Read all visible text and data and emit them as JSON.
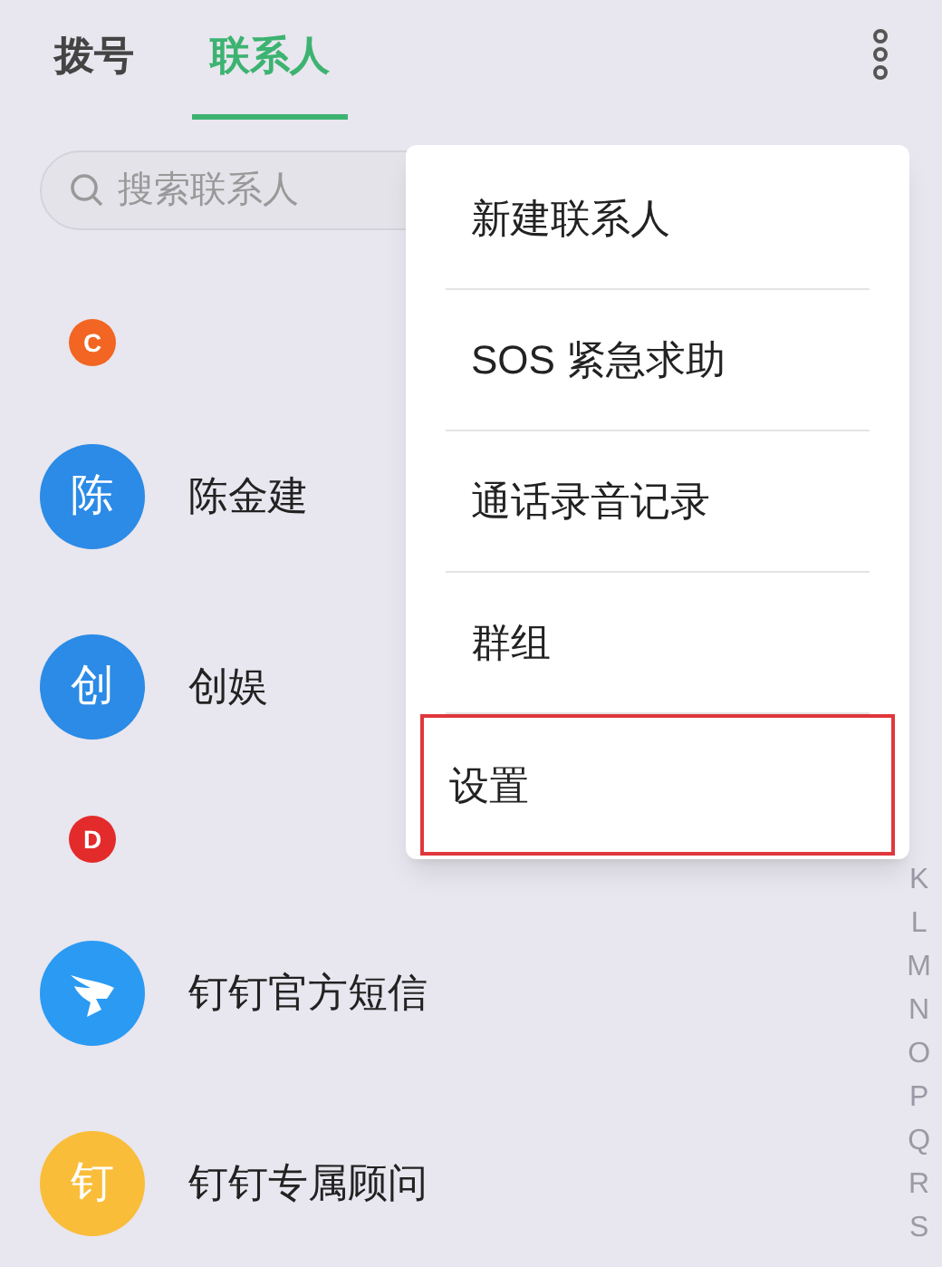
{
  "tabs": [
    {
      "label": "拨号",
      "selected": false
    },
    {
      "label": "联系人",
      "selected": true
    }
  ],
  "search": {
    "placeholder": "搜索联系人"
  },
  "sections": [
    {
      "letter": "C",
      "color": "#f26522",
      "contacts": [
        {
          "name": "陈金建",
          "avatar": "陈",
          "kind": "letter",
          "color": "#2b8be6"
        },
        {
          "name": "创娱",
          "avatar": "创",
          "kind": "letter",
          "color": "#2b8be6"
        }
      ]
    },
    {
      "letter": "D",
      "color": "#e32b2b",
      "contacts": [
        {
          "name": "钉钉官方短信",
          "kind": "logo",
          "color": "#2b9af3"
        },
        {
          "name": "钉钉专属顾问",
          "avatar": "钉",
          "kind": "letter",
          "color": "#f9bd3a"
        }
      ]
    }
  ],
  "index": [
    "K",
    "L",
    "M",
    "N",
    "O",
    "P",
    "Q",
    "R",
    "S"
  ],
  "menu": [
    {
      "label": "新建联系人",
      "highlighted": false
    },
    {
      "label": "SOS 紧急求助",
      "highlighted": false
    },
    {
      "label": "通话录音记录",
      "highlighted": false
    },
    {
      "label": "群组",
      "highlighted": false
    },
    {
      "label": "设置",
      "highlighted": true
    }
  ]
}
